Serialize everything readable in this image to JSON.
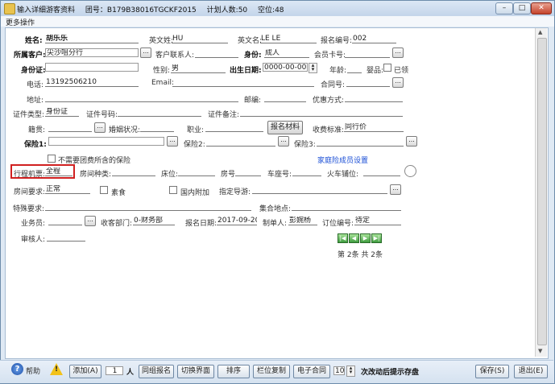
{
  "titlebar": {
    "title": "输入详细游客资料",
    "group_no": "团号：B179B38016TGCKF2015",
    "plan_count": "计划人数:50",
    "vacancy": "空位:48"
  },
  "window_buttons": {
    "min": "–",
    "max": "□",
    "close": "✕"
  },
  "menu": {
    "more": "更多操作"
  },
  "form": {
    "name_label": "姓名:",
    "name": "胡乐乐",
    "en_surname_label": "英文姓:",
    "en_surname": "HU",
    "en_name_label": "英文名:",
    "en_name": "LE LE",
    "reg_no_label": "报名编号:",
    "reg_no": "002",
    "customer_label": "所属客户:",
    "customer": "尖沙咀分行",
    "contact_label": "客户联系人:",
    "contact": "",
    "identity_label": "身份:",
    "identity": "成人",
    "member_card_label": "会员卡号:",
    "member_card": "",
    "id_card_label": "身份证:",
    "id_card": "",
    "gender_label": "性别:",
    "gender": "男",
    "birth_label": "出生日期:",
    "birth": "0000-00-00",
    "age_label": "年龄:",
    "age": "",
    "baby_label": "婴品:",
    "married_label": "已领",
    "phone_label": "电话:",
    "phone": "13192506210",
    "email_label": "Email:",
    "email": "",
    "contract_label": "合同号:",
    "contract": "",
    "address_label": "地址:",
    "address": "",
    "postcode_label": "邮编:",
    "postcode": "",
    "discount_label": "优惠方式:",
    "discount": "",
    "cert_type_label": "证件类型:",
    "cert_type": "身份证",
    "cert_no_label": "证件号码:",
    "cert_no": "",
    "cert_note_label": "证件备注:",
    "cert_note": "",
    "origin_label": "籍贯:",
    "origin": "",
    "marital_label": "婚姻状况:",
    "marital": "",
    "job_label": "职业:",
    "job": "",
    "signup_material": "报名材料",
    "fee_std_label": "收费标准:",
    "fee_std": "同行价",
    "ins1_label": "保险1:",
    "ins2_label": "保险2:",
    "ins3_label": "保险3:",
    "no_group_ins": "不需要团费所含的保险",
    "family_link": "家庭险成员设置",
    "ticket_label": "行程机票:",
    "ticket": "全程",
    "room_type_label": "房间种类:",
    "bed_label": "床位:",
    "room_no_label": "房号",
    "seat_label": "车座号:",
    "train_label": "火车铺位:",
    "room_req_label": "房间要求:",
    "room_req": "正常",
    "vegetarian_label": "素食",
    "domestic_label": "国内附加",
    "guide_label": "指定导游:",
    "special_label": "特殊要求:",
    "meeting_label": "集合地点:",
    "sales_label": "业务员:",
    "dept_label": "收客部门:",
    "dept": "0-财务部",
    "signup_date_label": "报名日期:",
    "signup_date": "2017-09-20",
    "maker_label": "制单人:",
    "maker": "彭婉杨",
    "order_no_label": "订位编号:",
    "order_no": "待定",
    "reviewer_label": "审核人:",
    "page_info": "第 2条 共 2条"
  },
  "bottom": {
    "help": "帮助",
    "add": "添加(A)",
    "count": "1",
    "person": "人",
    "group_signup": "同组报名",
    "switch_ui": "切换界面",
    "sort": "排序",
    "col_copy": "栏位复制",
    "e_contract": "电子合同",
    "save_every": "10",
    "save_hint": "次改动后提示存盘",
    "save": "保存(S)",
    "exit": "退出(E)"
  }
}
